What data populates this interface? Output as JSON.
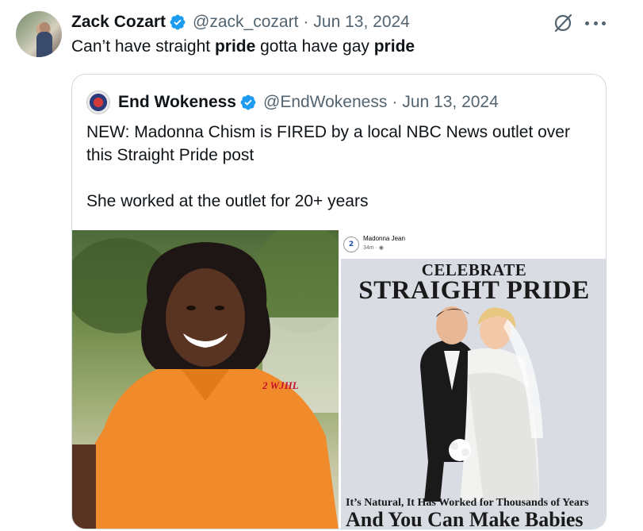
{
  "tweet": {
    "author_name": "Zack Cozart",
    "handle": "@zack_cozart",
    "separator": "·",
    "date": "Jun 13, 2024",
    "text_part1": "Can’t have straight ",
    "text_bold1": "pride",
    "text_part2": " gotta have gay ",
    "text_bold2": "pride"
  },
  "quote": {
    "author_name": "End Wokeness",
    "handle": "@EndWokeness",
    "separator": "·",
    "date": "Jun 13, 2024",
    "text_para1": "NEW: Madonna Chism is FIRED by a local NBC News outlet over this Straight Pride post",
    "text_para2": "She worked at the outlet for 20+ years"
  },
  "media": {
    "left_photo": {
      "shirt_logo": "WJHL",
      "shirt_logo_number": "2"
    },
    "right_post": {
      "station_logo": "2",
      "poster_name": "Madonna Jean",
      "poster_time": "34m · ",
      "headline_line1": "CELEBRATE",
      "headline_line2": "STRAIGHT PRIDE",
      "caption_line1": "It’s Natural, It Has Worked for Thousands of Years",
      "caption_line2": "And You Can Make Babies"
    }
  },
  "colors": {
    "verified": "#1d9bf0",
    "text_primary": "#0f1419",
    "text_secondary": "#536471",
    "border": "#cfd9de",
    "shirt_orange": "#f08a2a"
  },
  "icons": {
    "verified": "verified-badge-icon",
    "grok": "grok-icon",
    "more": "more-dots-icon"
  }
}
